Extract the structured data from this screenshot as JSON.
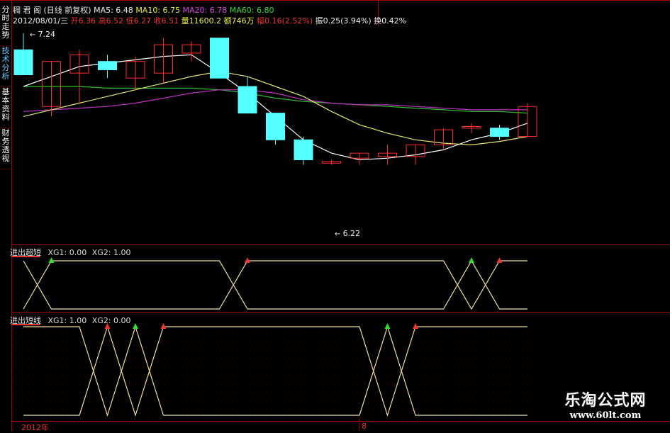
{
  "side_tabs": [
    {
      "label": "分时走势"
    },
    {
      "label": "技术分析"
    },
    {
      "label": "基本资料"
    },
    {
      "label": "财务透视"
    }
  ],
  "header": {
    "stock_name": "稠 君 阁",
    "period": "(日线 前复权)",
    "ma5": "MA5: 6.48",
    "ma10": "MA10: 6.75",
    "ma20": "MA20: 6.78",
    "ma60": "MA60: 6.80",
    "date": "2012/08/01/三",
    "open": "开6.36",
    "high": "高6.52",
    "low": "低6.27",
    "close": "收6.51",
    "volume": "量11600.2",
    "amount": "额746万",
    "change": "幅0.16(2.52%)",
    "amplitude": "振0.25(3.94%)",
    "turnover": "换0.42%"
  },
  "price_high_label": "7.24",
  "price_low_label": "6.22",
  "indicator1": {
    "title": "进出超短",
    "xg1": "XG1: 0.00",
    "xg2": "XG2: 1.00"
  },
  "indicator2": {
    "title": "进出短线",
    "xg1": "XG1: 1.00",
    "xg2": "XG2: 0.00"
  },
  "x_axis": {
    "year_label": "2012年",
    "month_label": "8"
  },
  "watermark": {
    "line1": "乐淘公式网",
    "line2": "www.60lt.com"
  },
  "colors": {
    "up": "#ff3030",
    "down": "#54ffff",
    "ma5": "#ffffff",
    "ma10": "#e8e870",
    "ma20": "#c030c0",
    "ma60": "#30c030",
    "xg": "#f0e0a0"
  },
  "chart_data": {
    "type": "candlestick",
    "price_range": [
      6.22,
      7.24
    ],
    "candles": [
      {
        "o": 7.12,
        "c": 6.97,
        "h": 7.22,
        "l": 6.97
      },
      {
        "o": 6.78,
        "c": 7.05,
        "h": 7.05,
        "l": 6.72
      },
      {
        "o": 6.98,
        "c": 7.09,
        "h": 7.12,
        "l": 6.8
      },
      {
        "o": 7.05,
        "c": 7.0,
        "h": 7.09,
        "l": 6.95
      },
      {
        "o": 6.95,
        "c": 7.05,
        "h": 7.08,
        "l": 6.88
      },
      {
        "o": 6.98,
        "c": 7.15,
        "h": 7.19,
        "l": 6.92
      },
      {
        "o": 7.1,
        "c": 7.15,
        "h": 7.17,
        "l": 7.05
      },
      {
        "o": 7.19,
        "c": 6.95,
        "h": 7.19,
        "l": 6.95
      },
      {
        "o": 6.9,
        "c": 6.74,
        "h": 6.96,
        "l": 6.74
      },
      {
        "o": 6.74,
        "c": 6.58,
        "h": 6.74,
        "l": 6.55
      },
      {
        "o": 6.58,
        "c": 6.46,
        "h": 6.6,
        "l": 6.43
      },
      {
        "o": 6.44,
        "c": 6.45,
        "h": 6.46,
        "l": 6.43
      },
      {
        "o": 6.47,
        "c": 6.5,
        "h": 6.5,
        "l": 6.43
      },
      {
        "o": 6.48,
        "c": 6.5,
        "h": 6.55,
        "l": 6.43
      },
      {
        "o": 6.48,
        "c": 6.55,
        "h": 6.55,
        "l": 6.43
      },
      {
        "o": 6.55,
        "c": 6.64,
        "h": 6.65,
        "l": 6.52
      },
      {
        "o": 6.65,
        "c": 6.66,
        "h": 6.68,
        "l": 6.62
      },
      {
        "o": 6.65,
        "c": 6.6,
        "h": 6.67,
        "l": 6.58
      },
      {
        "o": 6.6,
        "c": 6.78,
        "h": 6.8,
        "l": 6.6
      }
    ],
    "ma5": [
      6.9,
      6.96,
      7.02,
      7.04,
      7.06,
      7.08,
      7.09,
      6.98,
      6.86,
      6.72,
      6.58,
      6.5,
      6.46,
      6.47,
      6.49,
      6.52,
      6.58,
      6.62,
      6.68
    ],
    "ma10": [
      6.72,
      6.76,
      6.8,
      6.84,
      6.88,
      6.92,
      6.96,
      6.99,
      6.96,
      6.9,
      6.84,
      6.75,
      6.67,
      6.62,
      6.58,
      6.56,
      6.55,
      6.57,
      6.6
    ],
    "ma20": [
      6.75,
      6.76,
      6.77,
      6.78,
      6.8,
      6.83,
      6.86,
      6.88,
      6.88,
      6.86,
      6.82,
      6.8,
      6.79,
      6.79,
      6.78,
      6.77,
      6.76,
      6.76,
      6.76
    ],
    "ma60": [
      6.9,
      6.9,
      6.9,
      6.89,
      6.89,
      6.89,
      6.89,
      6.88,
      6.86,
      6.83,
      6.81,
      6.8,
      6.79,
      6.78,
      6.77,
      6.76,
      6.75,
      6.75,
      6.74
    ],
    "ind1_xg1": [
      1,
      0,
      0,
      0,
      0,
      0,
      0,
      0,
      1,
      1,
      1,
      1,
      1,
      1,
      1,
      1,
      0,
      1,
      1
    ],
    "ind2_xg1": [
      0,
      0,
      0,
      1,
      0,
      1,
      1,
      1,
      1,
      1,
      1,
      1,
      1,
      0,
      1,
      1,
      1,
      1,
      1
    ]
  }
}
